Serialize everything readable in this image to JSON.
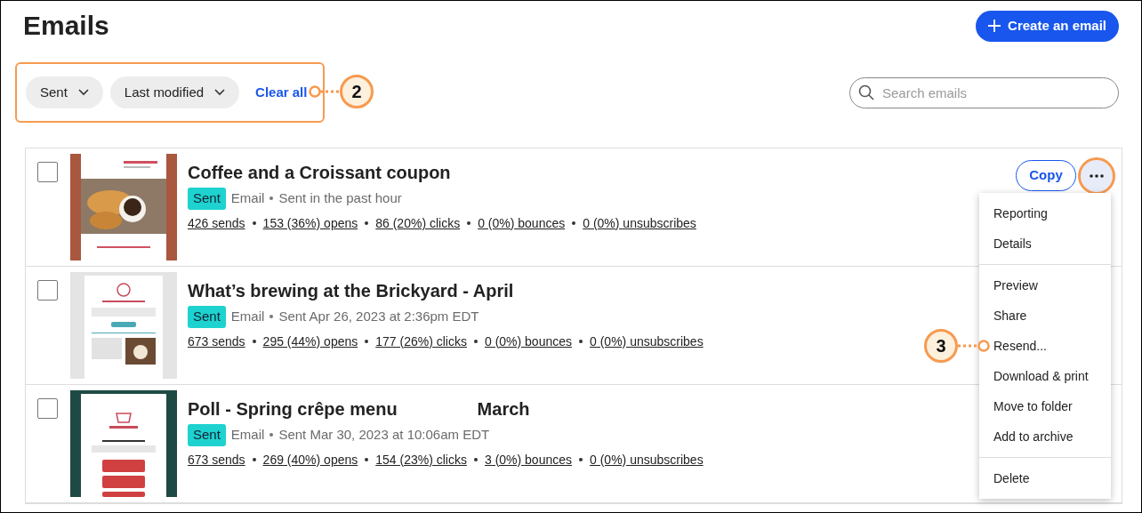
{
  "page": {
    "title": "Emails",
    "create_button": "Create an email"
  },
  "filters": {
    "chips": [
      "Sent",
      "Last modified"
    ],
    "clear": "Clear all"
  },
  "search": {
    "placeholder": "Search emails"
  },
  "emails": [
    {
      "checked": false,
      "title": "Coffee and a Croissant coupon",
      "status": "Sent",
      "type": "Email",
      "sent": "Sent in the past hour",
      "stats": [
        "426 sends",
        "153 (36%) opens",
        "86 (20%) clicks",
        "0 (0%) bounces",
        "0 (0%) unsubscribes"
      ]
    },
    {
      "checked": false,
      "title": "What’s brewing at the Brickyard - April",
      "status": "Sent",
      "type": "Email",
      "sent": "Sent Apr 26, 2023 at 2:36pm EDT",
      "stats": [
        "673 sends",
        "295 (44%) opens",
        "177 (26%) clicks",
        "0 (0%) bounces",
        "0 (0%) unsubscribes"
      ]
    },
    {
      "checked": false,
      "title": "Poll - Spring crêpe menu",
      "title_tail": "March",
      "status": "Sent",
      "type": "Email",
      "sent": "Sent Mar 30, 2023 at 10:06am EDT",
      "stats": [
        "673 sends",
        "269 (40%) opens",
        "154 (23%) clicks",
        "3 (0%) bounces",
        "0 (0%) unsubscribes"
      ]
    }
  ],
  "row_actions": {
    "copy": "Copy",
    "more_expanded": true
  },
  "menu": {
    "groups": [
      [
        "Reporting",
        "Details"
      ],
      [
        "Preview",
        "Share",
        "Resend...",
        "Download & print",
        "Move to folder",
        "Add to archive"
      ],
      [
        "Delete"
      ]
    ]
  },
  "callouts": [
    {
      "label": "2"
    },
    {
      "label": "3"
    }
  ]
}
